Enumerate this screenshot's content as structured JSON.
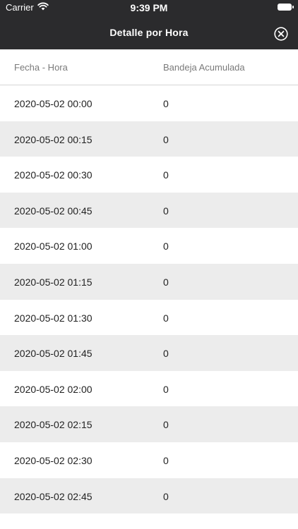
{
  "status": {
    "carrier": "Carrier",
    "time": "9:39 PM"
  },
  "header": {
    "title": "Detalle por Hora",
    "close_icon": "close-circle-icon"
  },
  "table": {
    "columns": [
      "Fecha - Hora",
      "Bandeja Acumulada"
    ],
    "rows": [
      {
        "datetime": "2020-05-02 00:00",
        "value": "0"
      },
      {
        "datetime": "2020-05-02 00:15",
        "value": "0"
      },
      {
        "datetime": "2020-05-02 00:30",
        "value": "0"
      },
      {
        "datetime": "2020-05-02 00:45",
        "value": "0"
      },
      {
        "datetime": "2020-05-02 01:00",
        "value": "0"
      },
      {
        "datetime": "2020-05-02 01:15",
        "value": "0"
      },
      {
        "datetime": "2020-05-02 01:30",
        "value": "0"
      },
      {
        "datetime": "2020-05-02 01:45",
        "value": "0"
      },
      {
        "datetime": "2020-05-02 02:00",
        "value": "0"
      },
      {
        "datetime": "2020-05-02 02:15",
        "value": "0"
      },
      {
        "datetime": "2020-05-02 02:30",
        "value": "0"
      },
      {
        "datetime": "2020-05-02 02:45",
        "value": "0"
      }
    ]
  },
  "colors": {
    "header_bg": "#2b2b2d",
    "stripe": "#ececec"
  }
}
